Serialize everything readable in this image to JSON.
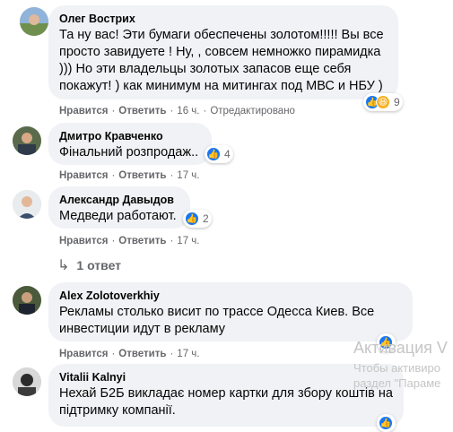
{
  "comments": [
    {
      "author": "Олег Вострих",
      "lines": [
        "Та ну вас! Эти бумаги обеспечены золотом!!!!! Вы все",
        "просто завидуете ! Ну, , совсем немножко пирамидка",
        "))) Но эти владельцы золотых запасов еще себя",
        "покажут! ) как минимум на митингах под МВС и НБУ )"
      ],
      "like_label": "Нравится",
      "reply_label": "Ответить",
      "time": "16 ч.",
      "edited": "Отредактировано",
      "reaction_count": "9",
      "reaction_icons": [
        "like-icon",
        "haha-icon"
      ]
    },
    {
      "author": "Дмитро Кравченко",
      "lines": [
        "Фінальний розпродаж.."
      ],
      "like_label": "Нравится",
      "reply_label": "Ответить",
      "time": "17 ч.",
      "reaction_count": "4",
      "reaction_icons": [
        "like-icon"
      ]
    },
    {
      "author": "Александр Давыдов",
      "lines": [
        "Медведи работают."
      ],
      "like_label": "Нравится",
      "reply_label": "Ответить",
      "time": "17 ч.",
      "reaction_count": "2",
      "reaction_icons": [
        "like-icon"
      ]
    },
    {
      "author": "Alex Zolotoverkhiy",
      "lines": [
        "Рекламы столько висит по трассе Одесса Киев. Все",
        "инвестиции идут в рекламу"
      ],
      "like_label": "Нравится",
      "reply_label": "Ответить",
      "time": "17 ч.",
      "reaction_icons": [
        "like-icon"
      ]
    },
    {
      "author": "Vitalii Kalnyi",
      "lines": [
        "Нехай Б2Б викладає номер картки для збору коштів на",
        "підтримку компанії."
      ],
      "reaction_icons": [
        "like-icon"
      ]
    }
  ],
  "replies_label": "1 ответ",
  "watermark": {
    "line1": "Активация V",
    "line2": "Чтобы активиро",
    "line3": "раздел \"Параме"
  },
  "colors": {
    "bubble": "#f0f2f5",
    "like_blue": "#1877f2",
    "meta_gray": "#65676b"
  }
}
